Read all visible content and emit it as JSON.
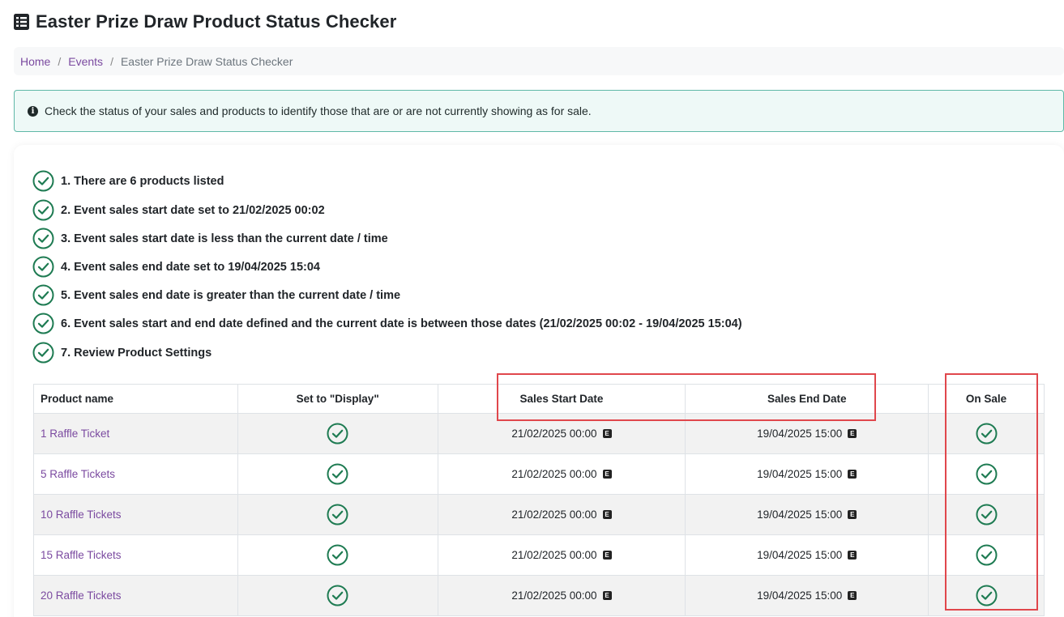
{
  "page": {
    "title": "Easter Prize Draw Product Status Checker",
    "title_icon": "list-icon"
  },
  "breadcrumb": {
    "items": [
      "Home",
      "Events"
    ],
    "separator": "/",
    "current": "Easter Prize Draw Status Checker"
  },
  "alert": {
    "icon": "info-icon",
    "text": "Check the status of your sales and products to identify those that are or are not currently showing as for sale."
  },
  "checklist": [
    "1. There are 6 products listed",
    "2. Event sales start date set to 21/02/2025 00:02",
    "3. Event sales start date is less than the current date / time",
    "4. Event sales end date set to 19/04/2025 15:04",
    "5. Event sales end date is greater than the current date / time",
    "6. Event sales start and end date defined and the current date is between those dates (21/02/2025 00:02 - 19/04/2025 15:04)",
    "7. Review Product Settings"
  ],
  "table": {
    "headers": {
      "name": "Product name",
      "display": "Set to \"Display\"",
      "start": "Sales Start Date",
      "end": "Sales End Date",
      "on_sale": "On Sale"
    },
    "rows": [
      {
        "name": "1 Raffle Ticket",
        "display": true,
        "start": "21/02/2025 00:00",
        "end": "19/04/2025 15:00",
        "on_sale": true
      },
      {
        "name": "5 Raffle Tickets",
        "display": true,
        "start": "21/02/2025 00:00",
        "end": "19/04/2025 15:00",
        "on_sale": true
      },
      {
        "name": "10 Raffle Tickets",
        "display": true,
        "start": "21/02/2025 00:00",
        "end": "19/04/2025 15:00",
        "on_sale": true
      },
      {
        "name": "15 Raffle Tickets",
        "display": true,
        "start": "21/02/2025 00:00",
        "end": "19/04/2025 15:00",
        "on_sale": true
      },
      {
        "name": "20 Raffle Tickets",
        "display": true,
        "start": "21/02/2025 00:00",
        "end": "19/04/2025 15:00",
        "on_sale": true
      }
    ],
    "date_badge": "E"
  },
  "colors": {
    "check_green": "#1e7b52",
    "link_purple": "#7b4aa0",
    "highlight_red": "#e0474c",
    "alert_border": "#5fb8a7"
  }
}
